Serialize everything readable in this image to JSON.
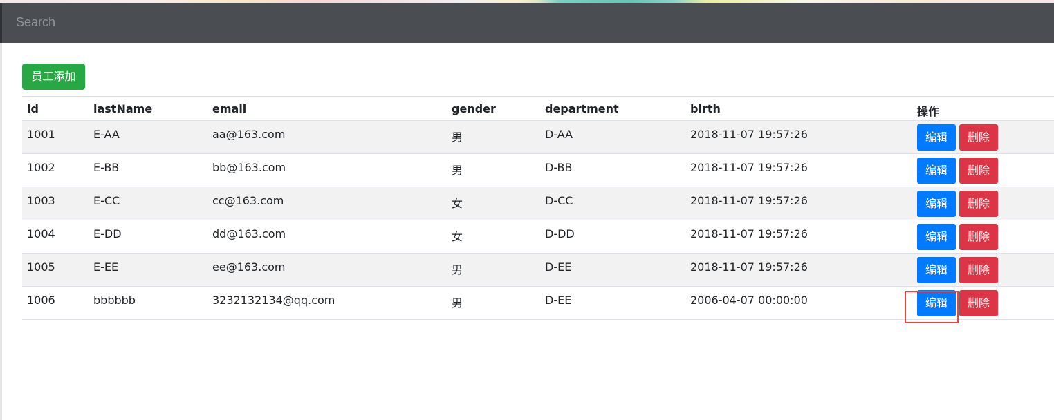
{
  "navbar": {
    "search_placeholder": "Search"
  },
  "actions": {
    "add_label": "员工添加"
  },
  "table": {
    "headers": {
      "id": "id",
      "lastName": "lastName",
      "email": "email",
      "gender": "gender",
      "department": "department",
      "birth": "birth",
      "operation": "操作"
    },
    "rows": [
      {
        "id": "1001",
        "lastName": "E-AA",
        "email": "aa@163.com",
        "gender": "男",
        "department": "D-AA",
        "birth": "2018-11-07 19:57:26",
        "edit": "编辑",
        "delete": "删除"
      },
      {
        "id": "1002",
        "lastName": "E-BB",
        "email": "bb@163.com",
        "gender": "男",
        "department": "D-BB",
        "birth": "2018-11-07 19:57:26",
        "edit": "编辑",
        "delete": "删除"
      },
      {
        "id": "1003",
        "lastName": "E-CC",
        "email": "cc@163.com",
        "gender": "女",
        "department": "D-CC",
        "birth": "2018-11-07 19:57:26",
        "edit": "编辑",
        "delete": "删除"
      },
      {
        "id": "1004",
        "lastName": "E-DD",
        "email": "dd@163.com",
        "gender": "女",
        "department": "D-DD",
        "birth": "2018-11-07 19:57:26",
        "edit": "编辑",
        "delete": "删除"
      },
      {
        "id": "1005",
        "lastName": "E-EE",
        "email": "ee@163.com",
        "gender": "男",
        "department": "D-EE",
        "birth": "2018-11-07 19:57:26",
        "edit": "编辑",
        "delete": "删除"
      },
      {
        "id": "1006",
        "lastName": "bbbbbb",
        "email": "3232132134@qq.com",
        "gender": "男",
        "department": "D-EE",
        "birth": "2006-04-07 00:00:00",
        "edit": "编辑",
        "delete": "删除"
      }
    ]
  },
  "colors": {
    "navbar": "#4a4d51",
    "add_button": "#28a745",
    "edit_button": "#007bff",
    "delete_button": "#dc3545",
    "highlight": "#e54545"
  }
}
